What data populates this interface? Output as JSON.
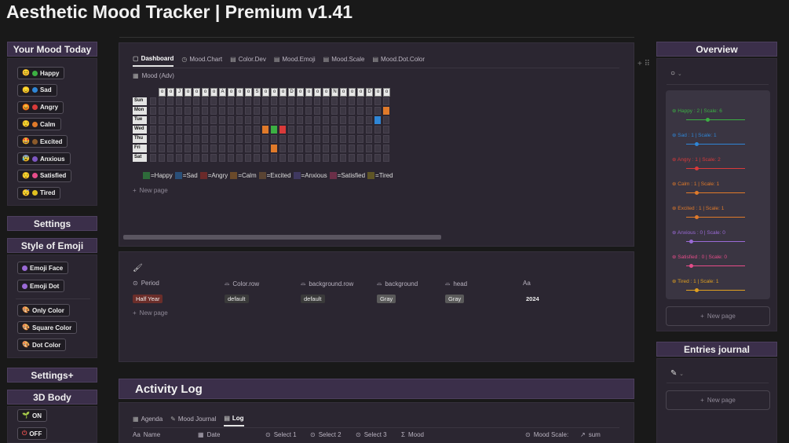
{
  "title": "Aesthetic Mood Tracker | Premium v1.41",
  "left": {
    "mood_today": "Your Mood Today",
    "moods": [
      {
        "label": "Happy",
        "emoji": "😊",
        "color": "#3cb043"
      },
      {
        "label": "Sad",
        "emoji": "😞",
        "color": "#2f86d6"
      },
      {
        "label": "Angry",
        "emoji": "😡",
        "color": "#d93a3a"
      },
      {
        "label": "Calm",
        "emoji": "😌",
        "color": "#e07a2a"
      },
      {
        "label": "Excited",
        "emoji": "🤩",
        "color": "#8b5a2b"
      },
      {
        "label": "Anxious",
        "emoji": "😰",
        "color": "#7e57c2"
      },
      {
        "label": "Satisfied",
        "emoji": "😌",
        "color": "#e64d8a"
      },
      {
        "label": "Tired",
        "emoji": "😴",
        "color": "#e0c020"
      }
    ],
    "settings": "Settings",
    "style_of_emoji": "Style of Emoji",
    "emoji_face": "Emoji Face",
    "emoji_dot": "Emoji Dot",
    "only_color": "Only Color",
    "square_color": "Square Color",
    "dot_color": "Dot Color",
    "settings_plus": "Settings+",
    "body_3d": "3D Body",
    "on": "ON",
    "off": "OFF"
  },
  "main": {
    "tabs": [
      "Dashboard",
      "Mood.Chart",
      "Color.Dev",
      "Mood.Emoji",
      "Mood.Scale",
      "Mood.Dot.Color"
    ],
    "view_name": "Mood (Adv)",
    "day_labels": [
      "Sun",
      "Mon",
      "Tue",
      "Wed",
      "Thu",
      "Fri",
      "Sat"
    ],
    "header_letters": [
      "o",
      "o",
      "J",
      "o",
      "o",
      "o",
      "o",
      "A",
      "o",
      "o",
      "o",
      "S",
      "o",
      "o",
      "o",
      "D",
      "o",
      "o",
      "o",
      "o",
      "N",
      "o",
      "o",
      "o",
      "D",
      "o",
      "o"
    ],
    "marks": [
      {
        "day": 1,
        "col": 27,
        "color": "#e07a2a"
      },
      {
        "day": 2,
        "col": 26,
        "color": "#2f86d6"
      },
      {
        "day": 3,
        "col": 13,
        "color": "#e07a2a"
      },
      {
        "day": 3,
        "col": 14,
        "color": "#3cb043"
      },
      {
        "day": 3,
        "col": 15,
        "color": "#d93a3a"
      },
      {
        "day": 5,
        "col": 14,
        "color": "#e07a2a"
      }
    ],
    "legend": [
      {
        "label": "=Happy",
        "color": "#2e6b3a"
      },
      {
        "label": "=Sad",
        "color": "#2a4f78"
      },
      {
        "label": "=Angry",
        "color": "#6b2a2a"
      },
      {
        "label": "=Calm",
        "color": "#6b4a2a"
      },
      {
        "label": "=Excited",
        "color": "#5a4433"
      },
      {
        "label": "=Anxious",
        "color": "#3f3860"
      },
      {
        "label": "=Satisfied",
        "color": "#6b2f48"
      },
      {
        "label": "=Tired",
        "color": "#5f5526"
      }
    ],
    "new_page": "New page",
    "props": {
      "headers": [
        "Period",
        "Color.row",
        "background.row",
        "background",
        "head",
        "Aa"
      ],
      "values": [
        "Half Year",
        "default",
        "default",
        "Gray",
        "Gray",
        "2024"
      ],
      "value_colors": [
        "#6b2e2a",
        "#3a3a3a",
        "#3a3a3a",
        "#5a5a5a",
        "#5a5a5a",
        ""
      ]
    },
    "activity_log": "Activity Log",
    "log_tabs": [
      "Agenda",
      "Mood Journal",
      "Log"
    ],
    "log_columns": [
      "Name",
      "Date",
      "Select 1",
      "Select 2",
      "Select 3",
      "Mood",
      "Mood Scale:",
      "sum"
    ]
  },
  "right": {
    "overview": "Overview",
    "rows": [
      {
        "label": "Happy : 2 | Scale: 6",
        "color": "#3cb043",
        "level": 0.33
      },
      {
        "label": "Sad : 1 | Scale: 1",
        "color": "#2f86d6",
        "level": 0.14
      },
      {
        "label": "Angry : 1 | Scale: 2",
        "color": "#d93a3a",
        "level": 0.14
      },
      {
        "label": "Calm : 1 | Scale: 1",
        "color": "#e07a2a",
        "level": 0.14
      },
      {
        "label": "Excited : 1 | Scale: 1",
        "color": "#e07a2a",
        "level": 0.14
      },
      {
        "label": "Anxious : 0 | Scale: 0",
        "color": "#9a6ad6",
        "level": 0.05
      },
      {
        "label": "Satisfied : 0 | Scale: 0",
        "color": "#e64d8a",
        "level": 0.05
      },
      {
        "label": "Tired : 1 | Scale: 1",
        "color": "#e0a020",
        "level": 0.14
      }
    ],
    "new_page": "New page",
    "entries_journal": "Entries journal"
  }
}
